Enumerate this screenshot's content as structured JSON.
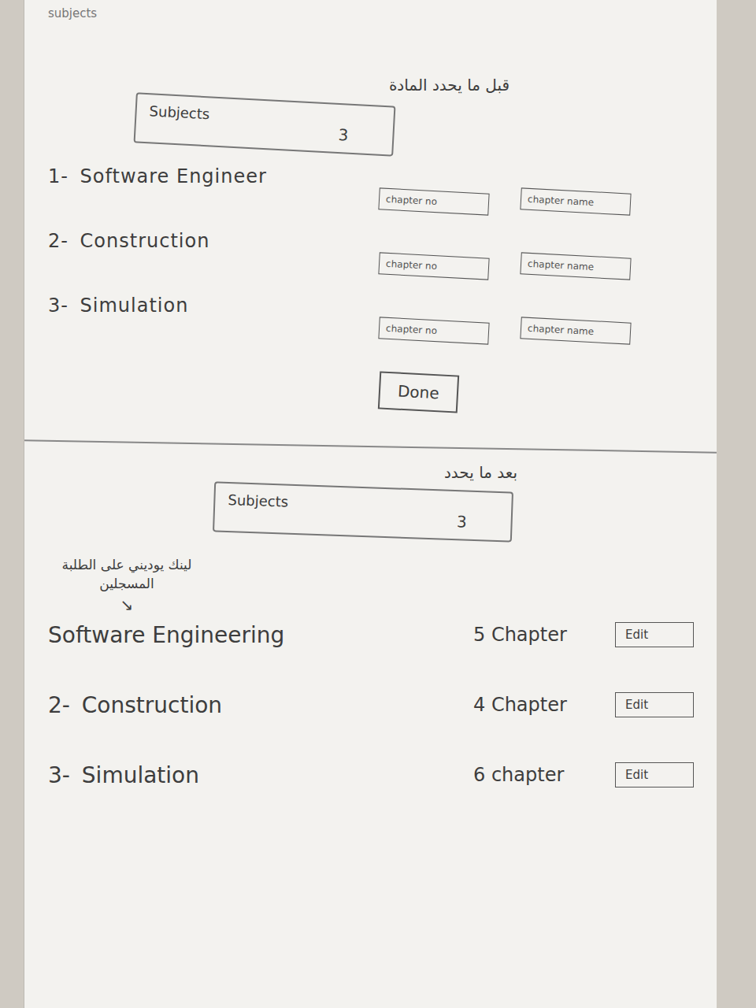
{
  "corner_label": "subjects",
  "before": {
    "heading": "قبل ما يحدد المادة",
    "subjects_box": {
      "label": "Subjects",
      "count": "3"
    },
    "rows": [
      {
        "number": "1-",
        "name": "Software Engineer",
        "chapter_no": "chapter no",
        "chapter_name": "chapter name"
      },
      {
        "number": "2-",
        "name": "Construction",
        "chapter_no": "chapter no",
        "chapter_name": "chapter name"
      },
      {
        "number": "3-",
        "name": "Simulation",
        "chapter_no": "chapter no",
        "chapter_name": "chapter name"
      }
    ],
    "done_button": "Done"
  },
  "after": {
    "heading": "بعد ما يحدد",
    "subjects_box": {
      "label": "Subjects",
      "count": "3"
    },
    "note": "لينك يوديني على الطلبة المسجلين",
    "note_arrow": "↘",
    "rows": [
      {
        "number": "",
        "name": "Software Engineering",
        "chapters": "5 Chapter",
        "edit": "Edit"
      },
      {
        "number": "2-",
        "name": "Construction",
        "chapters": "4 Chapter",
        "edit": "Edit"
      },
      {
        "number": "3-",
        "name": "Simulation",
        "chapters": "6 chapter",
        "edit": "Edit"
      }
    ]
  }
}
